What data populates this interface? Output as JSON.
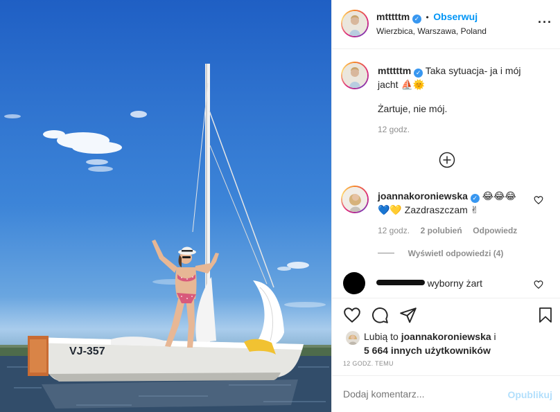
{
  "post": {
    "boat_registration": "VJ-357"
  },
  "header": {
    "username": "mtttttm",
    "separator": "•",
    "follow_label": "Obserwuj",
    "location": "Wierzbica, Warszawa, Poland",
    "more_icon": "more-horizontal-icon"
  },
  "caption": {
    "username": "mtttttm",
    "text_line1": "Taka sytuacja- ja i mój",
    "text_line2": "jacht",
    "emoji": "⛵🌞",
    "text2": "Żartuje, nie mój.",
    "time": "12 godz."
  },
  "load_more_icon": "plus-circle-icon",
  "comments": [
    {
      "username": "joannakoroniewska",
      "text_emoji1": "😂😂😂",
      "text_emoji2": "💙💛",
      "text": "Zazdraszczam",
      "text_emoji3": "✌",
      "time": "12 godz.",
      "likes": "2 polubień",
      "reply": "Odpowiedz",
      "view_replies": "Wyświetl odpowiedzi (4)"
    },
    {
      "username_redacted": "",
      "text": "wyborny żart"
    }
  ],
  "actions": {
    "liked_by_prefix": "Lubią to",
    "liked_by_user": "joannakoroniewska",
    "liked_by_mid": "i",
    "liked_by_count": "5 664 innych użytkowników",
    "timestamp": "12 GODZ. TEMU"
  },
  "comment_box": {
    "placeholder": "Dodaj komentarz...",
    "publish": "Opublikuj"
  },
  "colors": {
    "accent": "#0095f6",
    "verified": "#3897f0",
    "muted": "#8e8e8e",
    "publish_disabled": "#b2dffc"
  }
}
